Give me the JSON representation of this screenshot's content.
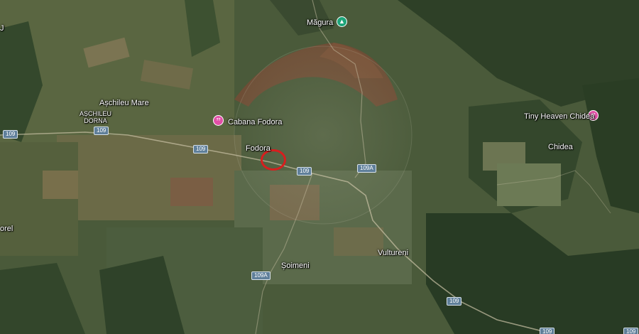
{
  "places": {
    "magura": "Măgura",
    "aschileu_mare": "Așchileu Mare",
    "aschileu_dorna": "AȘCHILEU\nDORNA",
    "cabana_fodora": "Cabana Fodora",
    "fodora": "Fodora",
    "tiny_heaven": "Tiny Heaven Chidea",
    "chidea": "Chidea",
    "vultureni": "Vultureni",
    "soimeni": "Șoimeni",
    "orel": "orel",
    "edge_j": "J"
  },
  "roads": {
    "r109_left": "109",
    "r109_aschileu": "109",
    "r109_mid": "109",
    "r109_fodora": "109",
    "r109a_east": "109A",
    "r109a_south": "109A",
    "r109_bottom": "109",
    "r109_corner": "109"
  },
  "poi": {
    "lodging_glyph": "??"
  },
  "icons": {
    "park": "tree-icon",
    "lodging": "lodging-icon"
  },
  "colors": {
    "marker": "#d81e1e",
    "poi_pink": "#e24fa7",
    "park_green": "#1ea57a",
    "road_badge": "#5f7f9a"
  }
}
